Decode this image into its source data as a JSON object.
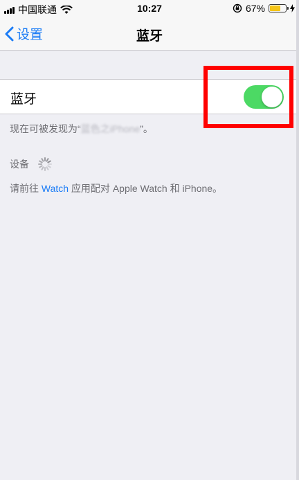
{
  "status_bar": {
    "carrier": "中国联通",
    "time": "10:27",
    "battery_percent": "67%",
    "battery_level": 0.67,
    "battery_color": "#f5c518"
  },
  "nav": {
    "back_label": "设置",
    "title": "蓝牙"
  },
  "bluetooth_cell": {
    "label": "蓝牙",
    "toggle_on": true,
    "toggle_color": "#4cd964"
  },
  "discoverable_note": {
    "prefix": "现在可被发现为“",
    "device_name": "蓝色之iPhone",
    "suffix": "”。"
  },
  "devices_section": {
    "header": "设备"
  },
  "watch_note": {
    "prefix": "请前往 ",
    "link": "Watch",
    "suffix": " 应用配对 Apple Watch 和 iPhone。"
  },
  "colors": {
    "accent": "#1b7cf6",
    "background": "#efeff4",
    "highlight": "#ff0000"
  }
}
